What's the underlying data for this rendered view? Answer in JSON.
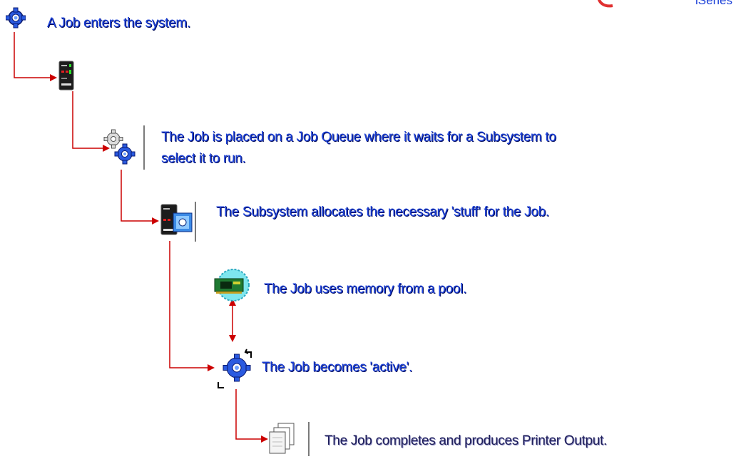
{
  "steps": [
    {
      "id": "enter",
      "text": "A Job enters the system.",
      "icon": "gear-icon"
    },
    {
      "id": "server",
      "text": "",
      "icon": "server-icon"
    },
    {
      "id": "queue",
      "text": "The Job is placed on a Job Queue where it waits for a Subsystem to select it to run.",
      "icon": "job-queue-gears-icon"
    },
    {
      "id": "subsystem",
      "text": "The Subsystem allocates the necessary 'stuff' for the Job.",
      "icon": "subsystem-icon"
    },
    {
      "id": "memory",
      "text": "The Job uses memory from a pool.",
      "icon": "memory-pool-icon"
    },
    {
      "id": "active",
      "text": "The Job becomes 'active'.",
      "icon": "active-job-gears-icon"
    },
    {
      "id": "output",
      "text": "The Job completes and produces Printer Output.",
      "icon": "printer-output-icon"
    }
  ],
  "header": {
    "logo_text": "iSeries"
  },
  "colors": {
    "text": "#1a3fd8",
    "connector": "#cc0000",
    "divider": "#7a7a7a"
  }
}
